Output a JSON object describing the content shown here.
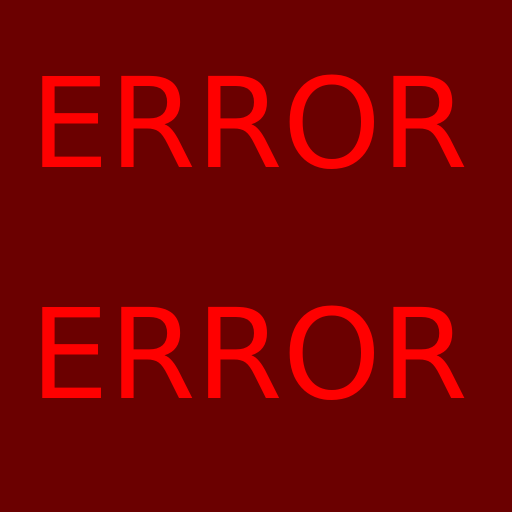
{
  "screen": {
    "background_color": "#6b0000",
    "text_color": "#ff0000",
    "lines": [
      {
        "text": "ERROR"
      },
      {
        "text": "ERROR"
      }
    ]
  }
}
